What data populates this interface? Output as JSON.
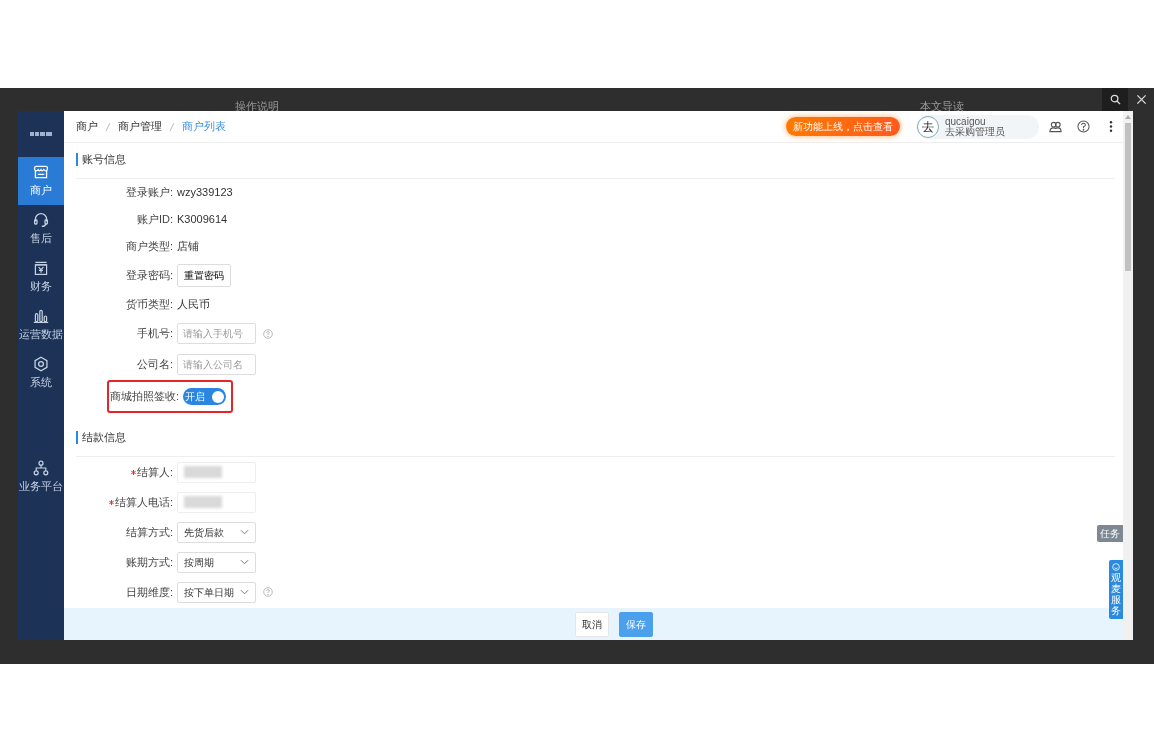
{
  "backdrop": {
    "texts": [
      "操作说明",
      "本文导读"
    ],
    "actions": [
      {
        "kind": "search"
      },
      {
        "kind": "close"
      }
    ]
  },
  "sidebar": {
    "items": [
      {
        "label": "商户",
        "kind": "shop",
        "selected": true
      },
      {
        "label": "售后",
        "kind": "headset",
        "selected": false
      },
      {
        "label": "财务",
        "kind": "yen",
        "selected": false
      },
      {
        "label": "运营数据",
        "kind": "bars",
        "selected": false
      },
      {
        "label": "系统",
        "kind": "gear",
        "selected": false
      }
    ],
    "lower_items": [
      {
        "label": "业务平台",
        "kind": "network",
        "selected": false
      }
    ]
  },
  "breadcrumb": [
    "商户",
    "商户管理",
    "商户列表"
  ],
  "header": {
    "promo": "新功能上线，点击查看",
    "user": {
      "avatar": "去",
      "name": "qucaigou",
      "role": "去采购管理员"
    },
    "actions": [
      {
        "kind": "users"
      },
      {
        "kind": "help"
      },
      {
        "kind": "more"
      }
    ]
  },
  "sections": [
    {
      "title": "账号信息",
      "fields": [
        {
          "kind": "text",
          "label": "登录账户:",
          "value": "wzy339123"
        },
        {
          "kind": "text",
          "label": "账户ID:",
          "value": "K3009614"
        },
        {
          "kind": "text",
          "label": "商户类型:",
          "value": "店铺"
        },
        {
          "kind": "button",
          "label": "登录密码:",
          "value": "重置密码"
        },
        {
          "kind": "text",
          "label": "货币类型:",
          "value": "人民币"
        },
        {
          "kind": "input",
          "label": "手机号:",
          "placeholder": "请输入手机号",
          "help": true
        },
        {
          "kind": "input",
          "label": "公司名:",
          "placeholder": "请输入公司名"
        },
        {
          "kind": "switch",
          "label": "商城拍照签收:",
          "value": "开启",
          "on": true,
          "highlighted": true
        }
      ]
    },
    {
      "title": "结款信息",
      "fields": [
        {
          "kind": "redacted",
          "label": "结算人:",
          "required": true
        },
        {
          "kind": "redacted",
          "label": "结算人电话:",
          "required": true
        },
        {
          "kind": "select",
          "label": "结算方式:",
          "value": "先货后款"
        },
        {
          "kind": "select",
          "label": "账期方式:",
          "value": "按周期"
        },
        {
          "kind": "select",
          "label": "日期维度:",
          "value": "按下单日期",
          "help": true
        }
      ]
    }
  ],
  "footer": {
    "buttons": [
      {
        "label": "取消",
        "kind": "default"
      },
      {
        "label": "保存",
        "kind": "primary"
      }
    ]
  },
  "side_tabs": [
    {
      "label": "任务",
      "kind": "task"
    },
    {
      "label": "观麦服务",
      "kind": "service"
    }
  ]
}
